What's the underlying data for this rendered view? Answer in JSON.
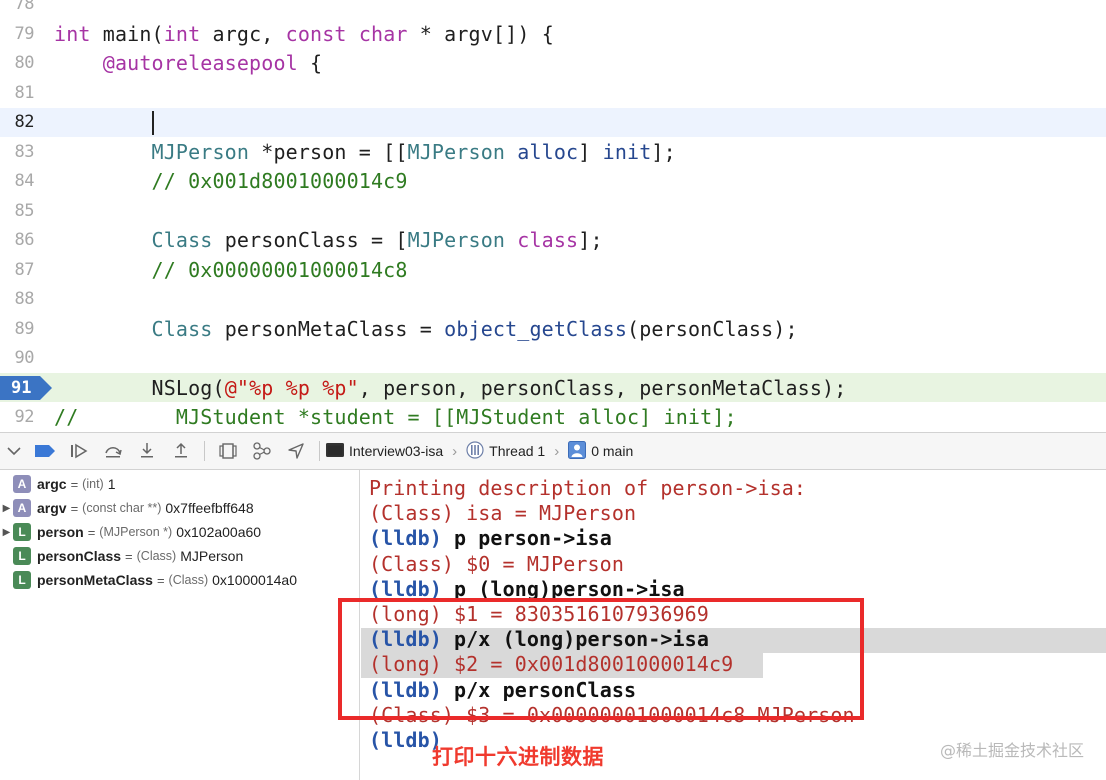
{
  "editor": {
    "lines": [
      {
        "num": "78"
      },
      {
        "num": "79",
        "parts": [
          "int",
          " main(",
          "int",
          " argc, ",
          "const",
          " ",
          "char",
          " * argv[]) {"
        ]
      },
      {
        "num": "80",
        "parts": [
          "    ",
          "@autoreleasepool",
          " {"
        ]
      },
      {
        "num": "81"
      },
      {
        "num": "82"
      },
      {
        "num": "83",
        "parts": [
          "        ",
          "MJPerson",
          " *person = [[",
          "MJPerson",
          " ",
          "alloc",
          "] ",
          "init",
          "];"
        ]
      },
      {
        "num": "84",
        "parts": [
          "        ",
          "// 0x001d8001000014c9"
        ]
      },
      {
        "num": "85"
      },
      {
        "num": "86",
        "parts": [
          "        ",
          "Class",
          " personClass = [",
          "MJPerson",
          " ",
          "class",
          "];"
        ]
      },
      {
        "num": "87",
        "parts": [
          "        ",
          "// 0x00000001000014c8"
        ]
      },
      {
        "num": "88"
      },
      {
        "num": "89",
        "parts": [
          "        ",
          "Class",
          " personMetaClass = ",
          "object_getClass",
          "(personClass);"
        ]
      },
      {
        "num": "90"
      },
      {
        "num": "91",
        "parts": [
          "        ",
          "NSLog(",
          "@\"%p %p %p\"",
          ", person, personClass, personMetaClass);"
        ]
      },
      {
        "num": "92",
        "parts": [
          "//        MJStudent *student = [[MJStudent alloc] init];"
        ]
      }
    ]
  },
  "toolbar": {
    "icons": [
      "console-toggle-icon",
      "breakpoints-toggle-icon",
      "continue-icon",
      "step-over-icon",
      "step-into-icon",
      "step-out-icon",
      "view-hierarchy-icon",
      "memory-graph-icon",
      "location-icon"
    ],
    "target": "Interview03-isa",
    "thread": "Thread 1",
    "frame": "0 main"
  },
  "variables": [
    {
      "badge": "A",
      "name": "argc",
      "type": "(int)",
      "value": "1",
      "expandable": false
    },
    {
      "badge": "A",
      "name": "argv",
      "type": "(const char **)",
      "value": "0x7ffeefbff648",
      "expandable": true
    },
    {
      "badge": "L",
      "name": "person",
      "type": "(MJPerson *)",
      "value": "0x102a00a60",
      "expandable": true
    },
    {
      "badge": "L",
      "name": "personClass",
      "type": "(Class)",
      "value": "MJPerson",
      "expandable": false
    },
    {
      "badge": "L",
      "name": "personMetaClass",
      "type": "(Class)",
      "value": "0x1000014a0",
      "expandable": false
    }
  ],
  "variables_eq": "=",
  "console": {
    "lines": [
      {
        "kind": "out",
        "text": "Printing description of person->isa:"
      },
      {
        "kind": "out",
        "text": "(Class) isa = MJPerson"
      },
      {
        "kind": "cmd",
        "prompt": "(lldb)",
        "text": " p person->isa"
      },
      {
        "kind": "out",
        "text": "(Class) $0 = MJPerson"
      },
      {
        "kind": "cmd",
        "prompt": "(lldb)",
        "text": " p (long)person->isa"
      },
      {
        "kind": "out",
        "text": "(long) $1 = 8303516107936969"
      },
      {
        "kind": "cmd",
        "prompt": "(lldb)",
        "text": " p/x (long)person->isa"
      },
      {
        "kind": "out",
        "text": "(long) $2 = 0x001d8001000014c9"
      },
      {
        "kind": "cmd",
        "prompt": "(lldb)",
        "text": " p/x personClass"
      },
      {
        "kind": "out",
        "text": "(Class) $3 = 0x00000001000014c8 MJPerson"
      },
      {
        "kind": "cmd",
        "prompt": "(lldb)",
        "text": ""
      }
    ]
  },
  "annotation": {
    "text": "打印十六进制数据",
    "color": "#ea2a2a"
  },
  "watermark": "@稀土掘金技术社区",
  "colors": {
    "keyword": "#a634a4",
    "class": "#3a7b84",
    "comment": "#2f7b21",
    "string": "#c41a16",
    "breakpoint": "#3b74c4",
    "current_line": "#edf3fe",
    "break_line": "#e8f4e1"
  }
}
